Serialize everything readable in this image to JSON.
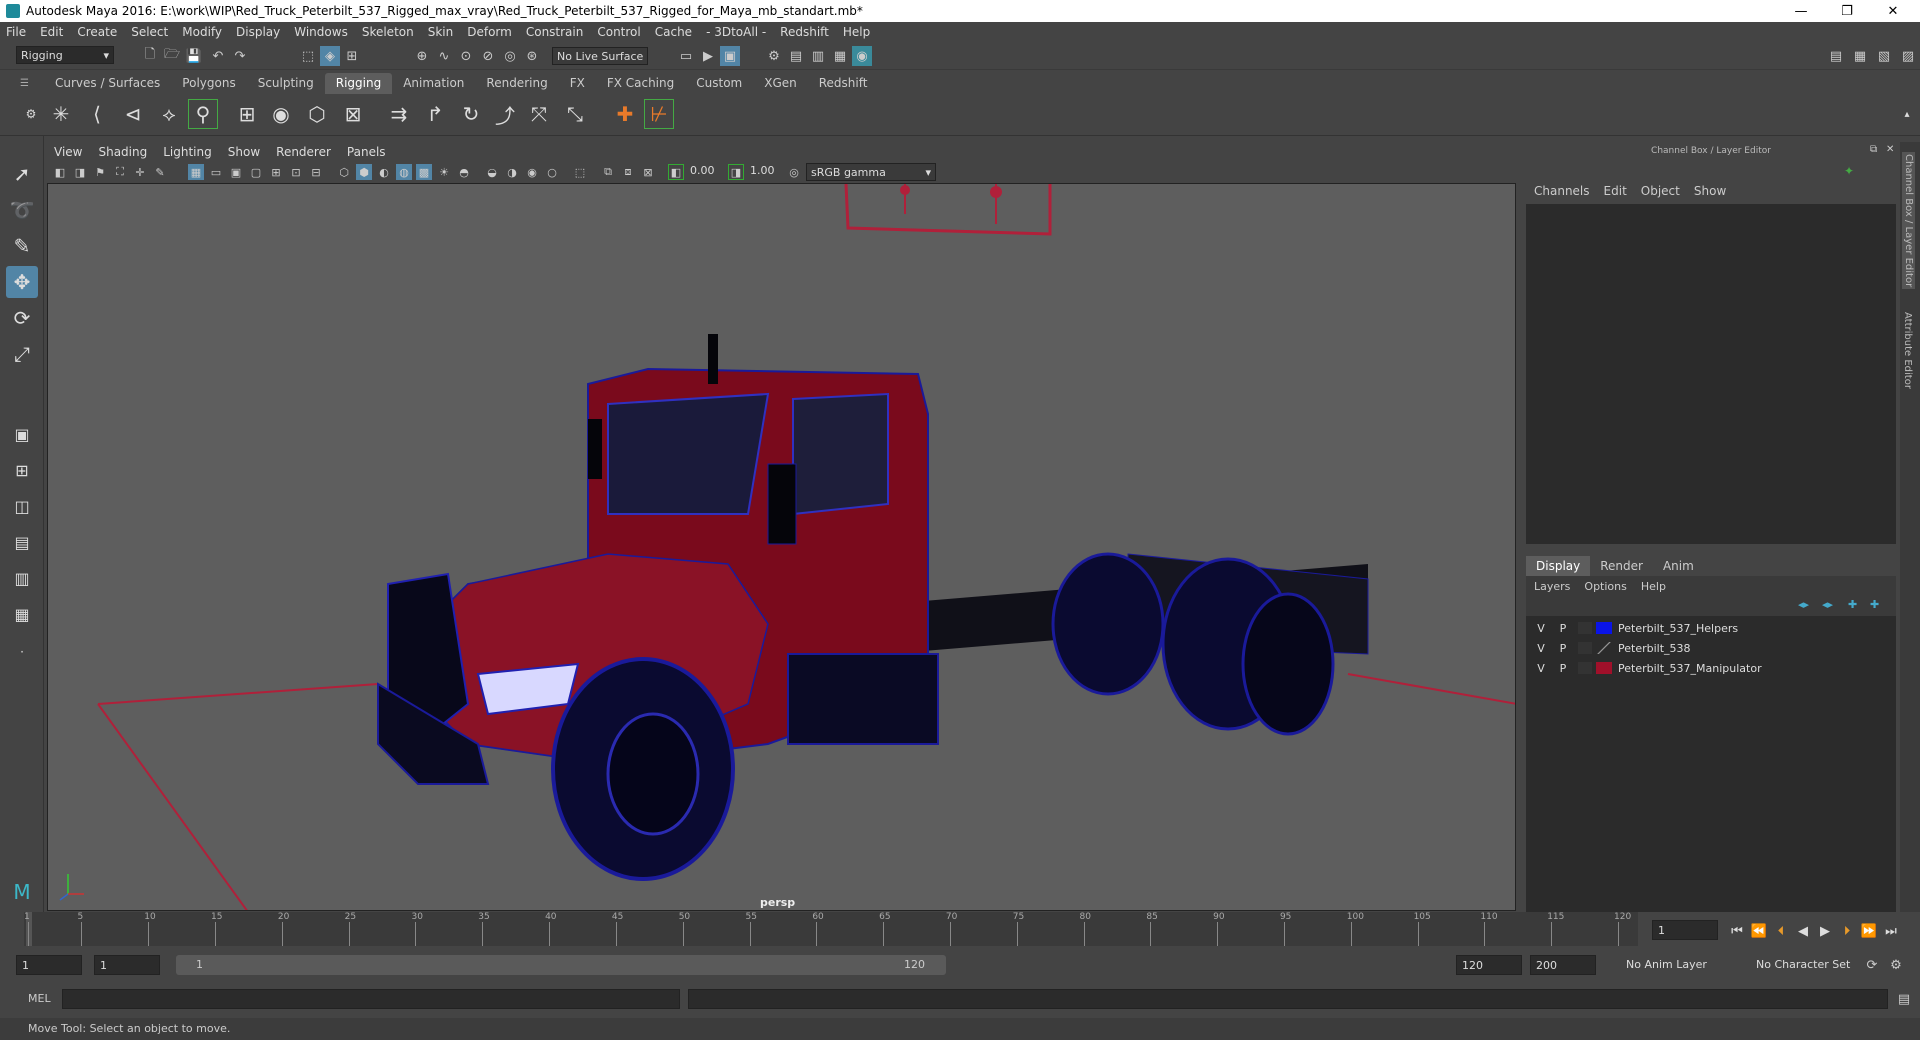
{
  "window": {
    "title": "Autodesk Maya 2016: E:\\work\\WIP\\Red_Truck_Peterbilt_537_Rigged_max_vray\\Red_Truck_Peterbilt_537_Rigged_for_Maya_mb_standart.mb*",
    "minimize": "—",
    "restore": "❐",
    "close": "✕"
  },
  "menu": [
    "File",
    "Edit",
    "Create",
    "Select",
    "Modify",
    "Display",
    "Windows",
    "Skeleton",
    "Skin",
    "Deform",
    "Constrain",
    "Control",
    "Cache",
    "- 3DtoAll -",
    "Redshift",
    "Help"
  ],
  "status_line": {
    "menu_set": "Rigging",
    "live_surface": "No Live Surface"
  },
  "shelf_tabs": [
    "Curves / Surfaces",
    "Polygons",
    "Sculpting",
    "Rigging",
    "Animation",
    "Rendering",
    "FX",
    "FX Caching",
    "Custom",
    "XGen",
    "Redshift"
  ],
  "active_shelf": "Rigging",
  "viewport": {
    "menu": [
      "View",
      "Shading",
      "Lighting",
      "Show",
      "Renderer",
      "Panels"
    ],
    "near_value": "0.00",
    "far_value": "1.00",
    "color_space": "sRGB gamma",
    "camera_label": "persp"
  },
  "channel_box": {
    "title": "Channel Box / Layer Editor",
    "menu": [
      "Channels",
      "Edit",
      "Object",
      "Show"
    ]
  },
  "layer_editor": {
    "tabs": [
      "Display",
      "Render",
      "Anim"
    ],
    "active_tab": "Display",
    "menu": [
      "Layers",
      "Options",
      "Help"
    ],
    "layers": [
      {
        "v": "V",
        "p": "P",
        "name": "Peterbilt_537_Helpers",
        "color": "#0a14e8"
      },
      {
        "v": "V",
        "p": "P",
        "name": "Peterbilt_538",
        "color": ""
      },
      {
        "v": "V",
        "p": "P",
        "name": "Peterbilt_537_Manipulator",
        "color": "#a0102a"
      }
    ]
  },
  "side_tabs": [
    "Channel Box / Layer Editor",
    "Attribute Editor"
  ],
  "time_slider": {
    "ticks": [
      "1",
      "5",
      "10",
      "15",
      "20",
      "25",
      "30",
      "35",
      "40",
      "45",
      "50",
      "55",
      "60",
      "65",
      "70",
      "75",
      "80",
      "85",
      "90",
      "95",
      "100",
      "105",
      "110",
      "115",
      "120"
    ],
    "current_frame": "1"
  },
  "range_slider": {
    "start": "1",
    "playback_start": "1",
    "range_start_label": "1",
    "range_end_label": "120",
    "playback_end": "120",
    "end": "200",
    "anim_layer": "No Anim Layer",
    "character_set": "No Character Set"
  },
  "command_line": {
    "label": "MEL"
  },
  "help_line": "Move Tool: Select an object to move.",
  "colors": {
    "accent": "#5285a6",
    "truck_body": "#7a0a1c",
    "wire": "#1a1a9a",
    "grid_red": "#b0203a"
  }
}
